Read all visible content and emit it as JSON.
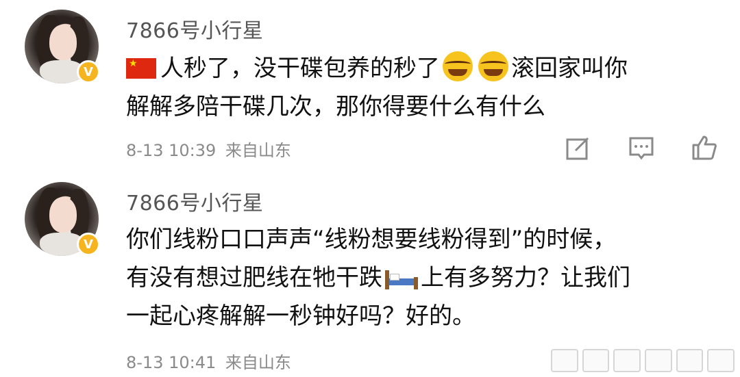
{
  "comments": [
    {
      "username": "7866号小行星",
      "text_line1_after_flag": "人秒了，没干碟包养的秒了",
      "text_line1_end": "滚回家叫你",
      "text_line2": "解解多陪干碟几次，那你得要什么有什么",
      "timestamp": "8-13 10:39",
      "location": "来自山东"
    },
    {
      "username": "7866号小行星",
      "text_line1": "你们线粉口口声声“线粉想要线粉得到”的时候，",
      "text_line2_before_bed": "有没有想过肥线在牠干跌",
      "text_line2_after_bed": "上有多努力？让我们",
      "text_line3": "一起心疼解解一秒钟好吗？好的。",
      "timestamp": "8-13 10:41",
      "location": "来自山东"
    }
  ],
  "icons": {
    "flag": "china-flag-icon",
    "cry": "laughing-crying-icon",
    "bed": "bed-icon",
    "edit": "edit-icon",
    "comment": "comment-icon",
    "like": "like-icon"
  },
  "colors": {
    "badge": "#f6b51e",
    "text": "#111111",
    "meta": "#8a8a8a",
    "username": "#555555"
  }
}
